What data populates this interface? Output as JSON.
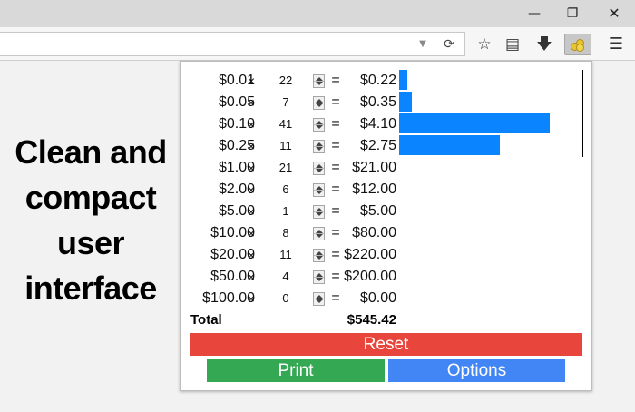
{
  "window": {
    "minimize_glyph": "—",
    "restore_glyph": "❐",
    "close_glyph": "✕"
  },
  "toolbar": {
    "icons": [
      "dropdown-arrow-icon",
      "refresh-icon",
      "bookmark-star-icon",
      "reading-list-icon",
      "download-icon",
      "coin-extension-icon",
      "hamburger-menu-icon"
    ]
  },
  "tagline": [
    "Clean and",
    "compact",
    "user",
    "interface"
  ],
  "calculator": {
    "times_symbol": "×",
    "equals_symbol": "=",
    "bar_color": "#0a84ff",
    "bar_max_value": 4.1,
    "rows": [
      {
        "denom": "$0.01",
        "qty": "22",
        "amount": "$0.22",
        "value": 0.22,
        "has_bar": true
      },
      {
        "denom": "$0.05",
        "qty": "7",
        "amount": "$0.35",
        "value": 0.35,
        "has_bar": true
      },
      {
        "denom": "$0.10",
        "qty": "41",
        "amount": "$4.10",
        "value": 4.1,
        "has_bar": true
      },
      {
        "denom": "$0.25",
        "qty": "11",
        "amount": "$2.75",
        "value": 2.75,
        "has_bar": true
      },
      {
        "denom": "$1.00",
        "qty": "21",
        "amount": "$21.00",
        "value": 21.0,
        "has_bar": false
      },
      {
        "denom": "$2.00",
        "qty": "6",
        "amount": "$12.00",
        "value": 12.0,
        "has_bar": false
      },
      {
        "denom": "$5.00",
        "qty": "1",
        "amount": "$5.00",
        "value": 5.0,
        "has_bar": false
      },
      {
        "denom": "$10.00",
        "qty": "8",
        "amount": "$80.00",
        "value": 80.0,
        "has_bar": false
      },
      {
        "denom": "$20.00",
        "qty": "11",
        "amount": "$220.00",
        "value": 220.0,
        "has_bar": false
      },
      {
        "denom": "$50.00",
        "qty": "4",
        "amount": "$200.00",
        "value": 200.0,
        "has_bar": false
      },
      {
        "denom": "$100.00",
        "qty": "0",
        "amount": "$0.00",
        "value": 0.0,
        "has_bar": false
      }
    ],
    "total_label": "Total",
    "total_value": "$545.42"
  },
  "buttons": {
    "reset": "Reset",
    "print": "Print",
    "options": "Options"
  },
  "colors": {
    "reset": "#e8453c",
    "print": "#34a853",
    "options": "#4285f4"
  }
}
